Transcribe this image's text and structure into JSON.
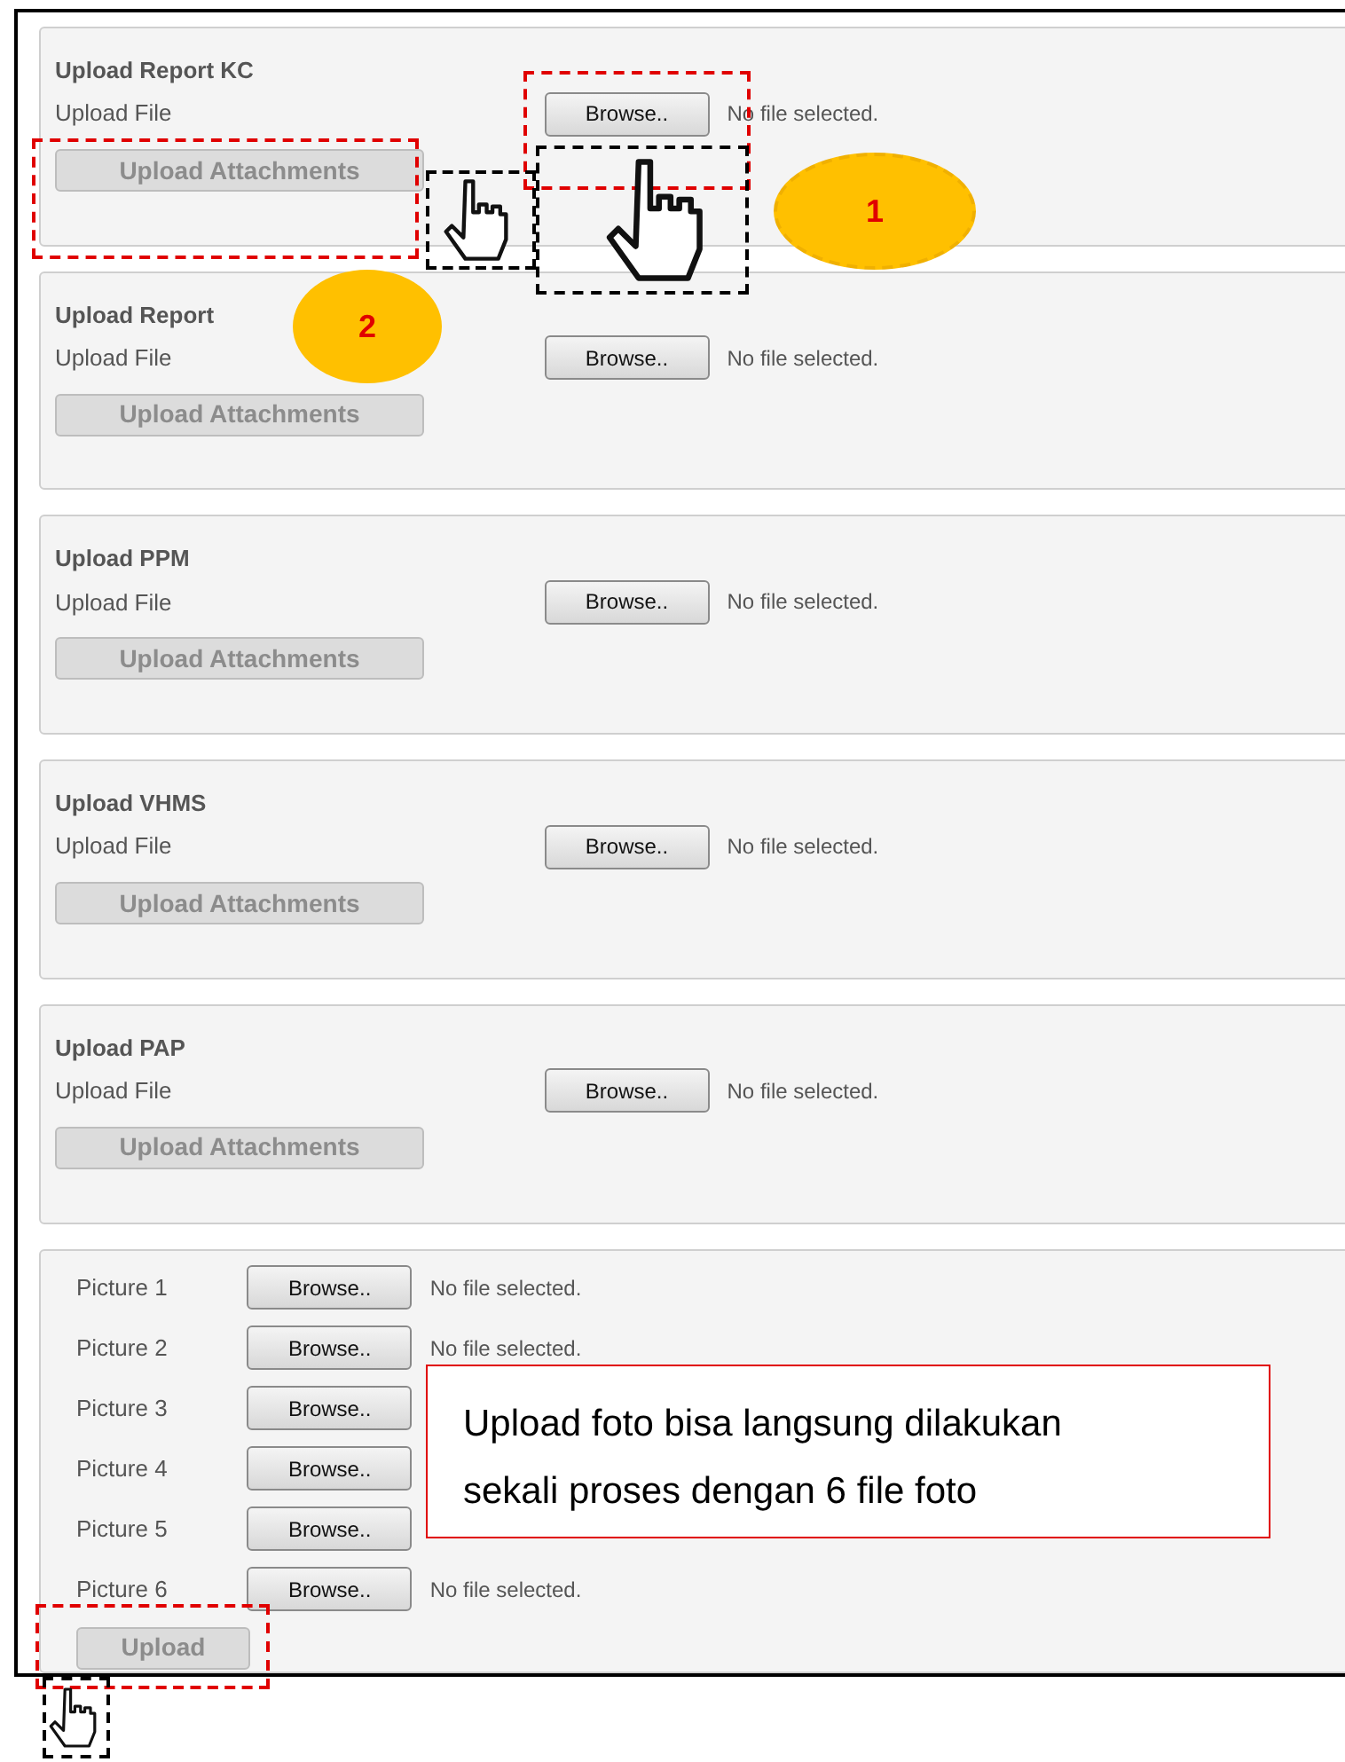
{
  "sections": [
    {
      "title": "Upload Report KC",
      "field_label": "Upload File",
      "browse": "Browse..",
      "file_status": "No file selected.",
      "action": {
        "label": "Upload Attachments",
        "disabled": true
      }
    },
    {
      "title": "Upload Report",
      "field_label": "Upload File",
      "browse": "Browse..",
      "file_status": "No file selected.",
      "action": {
        "label": "Upload Attachments",
        "disabled": true
      }
    },
    {
      "title": "Upload PPM",
      "field_label": "Upload File",
      "browse": "Browse..",
      "file_status": "No file selected.",
      "action": {
        "label": "Upload Attachments",
        "disabled": true
      }
    },
    {
      "title": "Upload VHMS",
      "field_label": "Upload File",
      "browse": "Browse..",
      "file_status": "No file selected.",
      "action": {
        "label": "Upload Attachments",
        "disabled": true
      }
    },
    {
      "title": "Upload PAP",
      "field_label": "Upload File",
      "browse": "Browse..",
      "file_status": "No file selected.",
      "action": {
        "label": "Upload Attachments",
        "disabled": true
      }
    }
  ],
  "pictures": {
    "rows": [
      {
        "label": "Picture 1",
        "browse": "Browse..",
        "file_status": "No file selected."
      },
      {
        "label": "Picture 2",
        "browse": "Browse..",
        "file_status": "No file selected."
      },
      {
        "label": "Picture 3",
        "browse": "Browse.."
      },
      {
        "label": "Picture 4",
        "browse": "Browse.."
      },
      {
        "label": "Picture 5",
        "browse": "Browse.."
      },
      {
        "label": "Picture 6",
        "browse": "Browse..",
        "file_status": "No file selected."
      }
    ],
    "action": {
      "label": "Upload",
      "disabled": true
    }
  },
  "annotations": {
    "steps": [
      "1",
      "2"
    ],
    "note": "Upload foto bisa langsung dilakukan sekali proses dengan 6 file foto"
  }
}
